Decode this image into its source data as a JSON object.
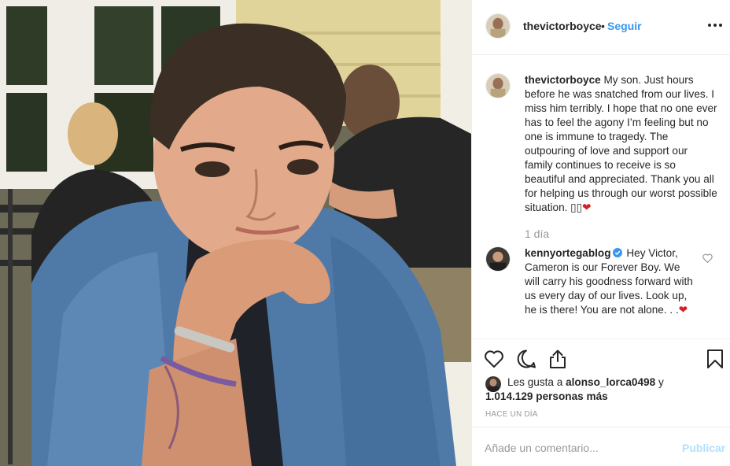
{
  "post": {
    "username": "thevictorboyce",
    "dot": "•",
    "follow_label": "Seguir",
    "caption": "My son. Just hours before he was snatched from our lives. I miss him terribly. I hope that no one ever has to feel the agony I’m feeling but no one is immune to tragedy. The outpouring of love and support our family continues to receive is so beautiful and appreciated. Thank you all for helping us through our worst possible situation. ▯▯",
    "caption_heart": "❤",
    "caption_time": "1 día"
  },
  "comment": {
    "username": "kennyortegablog",
    "verified": true,
    "text": "Hey Victor, Cameron is our Forever Boy. We will carry his goodness forward with us every day of our lives. Look up, he is there! You are not alone. . .",
    "heart": "❤"
  },
  "likes": {
    "prefix": "Les gusta a",
    "user": "alonso_lorca0498",
    "suffix": "y",
    "count": "1.014.129",
    "count_suffix": "personas más"
  },
  "post_date": "HACE UN DÍA",
  "comment_box": {
    "placeholder": "Añade un comentario...",
    "publish_label": "Publicar"
  },
  "colors": {
    "accent": "#3897f0",
    "publish_disabled": "#b2dffc",
    "heart_red": "#ed4956",
    "muted": "#999999"
  },
  "icons": [
    "more-icon",
    "verified-badge-icon",
    "heart-outline-icon",
    "comment-icon",
    "share-icon",
    "bookmark-icon"
  ]
}
